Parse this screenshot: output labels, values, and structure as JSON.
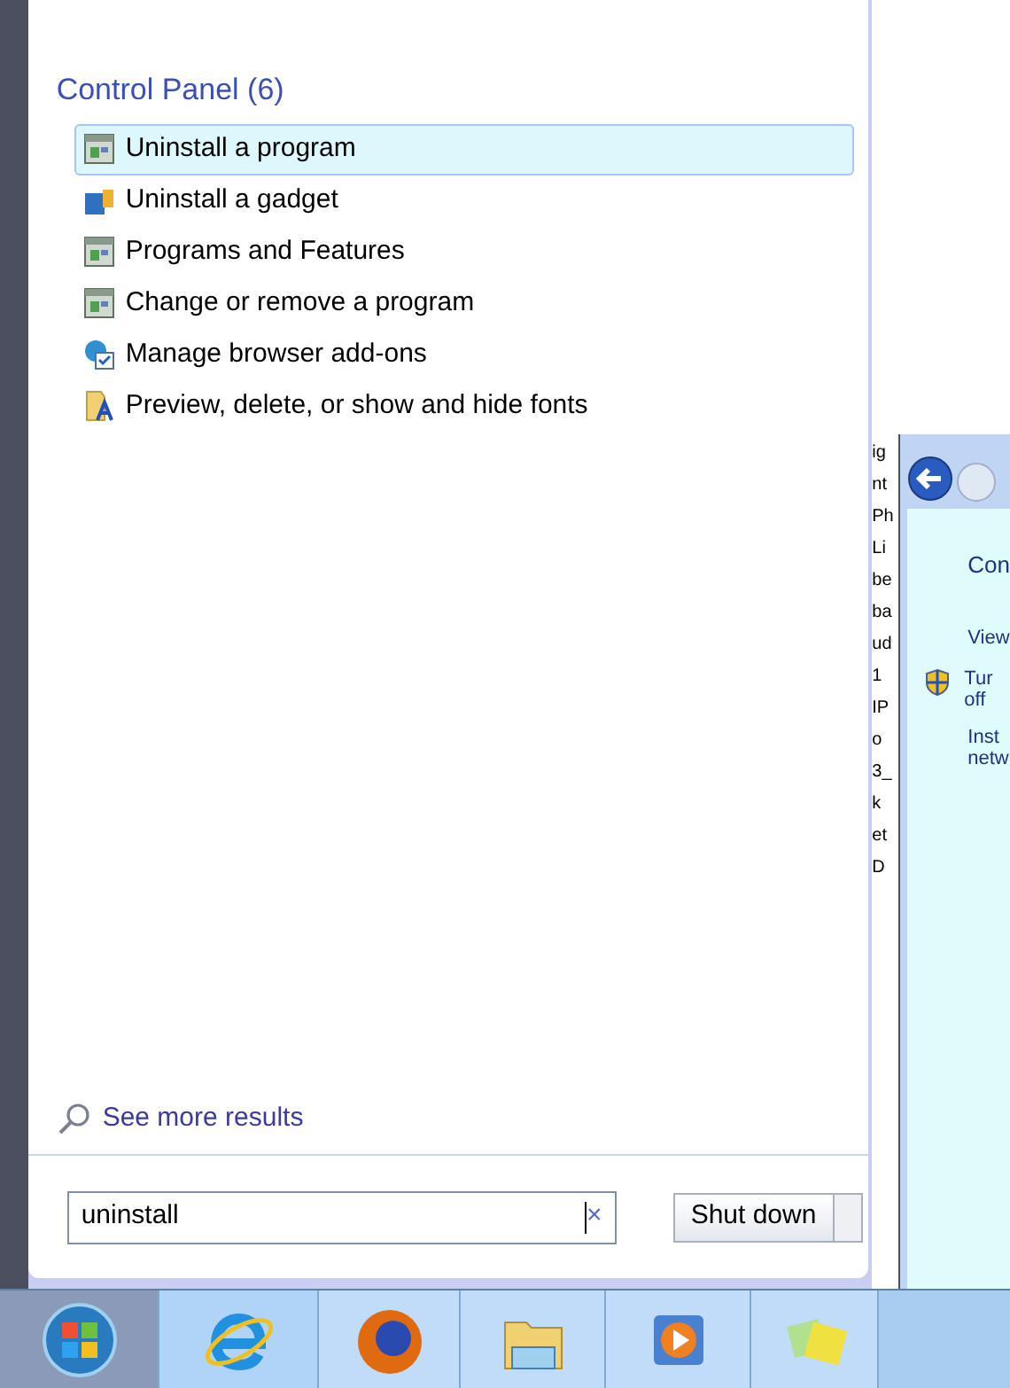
{
  "start_menu": {
    "group_title": "Control Panel (6)",
    "results": [
      {
        "label": "Uninstall a program",
        "kind": "program",
        "selected": true
      },
      {
        "label": "Uninstall a gadget",
        "kind": "gadget",
        "selected": false
      },
      {
        "label": "Programs and Features",
        "kind": "program",
        "selected": false
      },
      {
        "label": "Change or remove a program",
        "kind": "program",
        "selected": false
      },
      {
        "label": "Manage browser add-ons",
        "kind": "browser",
        "selected": false
      },
      {
        "label": "Preview, delete, or show and hide fonts",
        "kind": "fonts",
        "selected": false
      }
    ],
    "see_more": "See more results",
    "search": {
      "value": "uninstall",
      "clear": "×"
    },
    "shutdown_button": "Shut down"
  },
  "background_document": {
    "fragments": [
      "ig",
      "nt",
      "Ph",
      "Li",
      "be",
      "ba",
      "ud",
      "1",
      "IP",
      "o",
      "3_",
      "k",
      "et",
      "D"
    ]
  },
  "background_window": {
    "texts": [
      "Con",
      "View",
      "Tur",
      "off",
      "Inst",
      "netw"
    ]
  },
  "taskbar": {
    "items": [
      {
        "kind": "start"
      },
      {
        "kind": "ie"
      },
      {
        "kind": "firefox"
      },
      {
        "kind": "explorer"
      },
      {
        "kind": "media"
      },
      {
        "kind": "notes"
      }
    ]
  }
}
